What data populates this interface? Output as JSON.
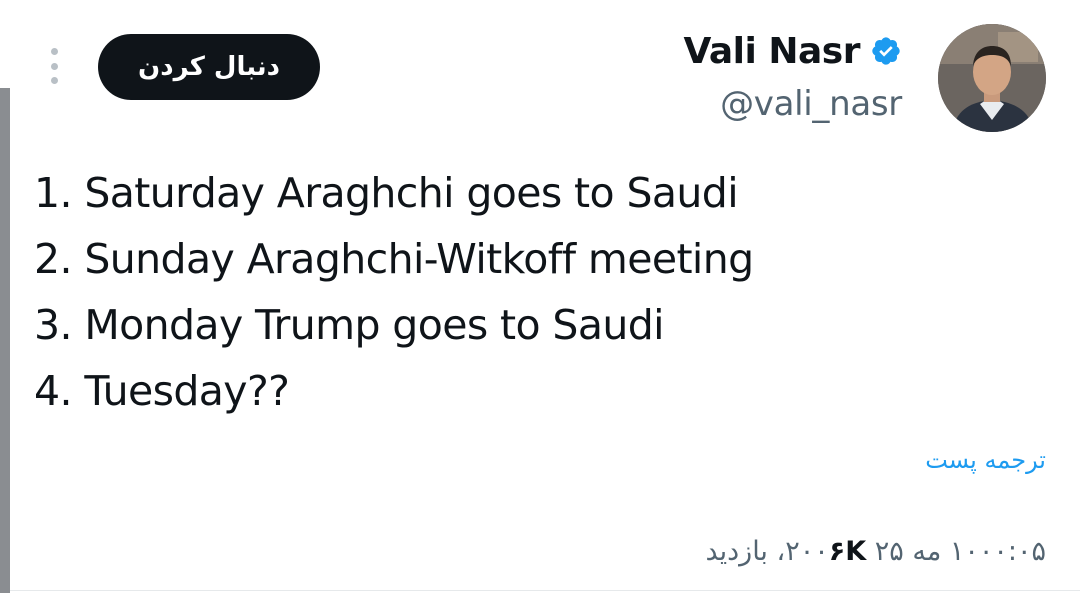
{
  "header": {
    "follow_label": "دنبال کردن",
    "more_icon": "more-vertical-icon"
  },
  "author": {
    "display_name": "Vali Nasr",
    "handle": "@vali_nasr",
    "verified_icon": "verified-badge-icon",
    "verified_color": "#1d9bf0"
  },
  "tweet": {
    "lines": [
      "1. Saturday Araghchi goes to Saudi",
      "2. Sunday Araghchi-Witkoff meeting",
      "3. Monday Trump goes to Saudi",
      "4. Tuesday??"
    ],
    "translate_label": "ترجمه پست"
  },
  "meta": {
    "timestamp": "۱۰۰۰:۰۵ مه ۲۵ ۲۰۰",
    "views_count": "۶K",
    "views_label": "، بازدید"
  },
  "colors": {
    "text_primary": "#0f1419",
    "text_secondary": "#536471",
    "accent": "#1d9bf0",
    "follow_bg": "#0f1419"
  }
}
